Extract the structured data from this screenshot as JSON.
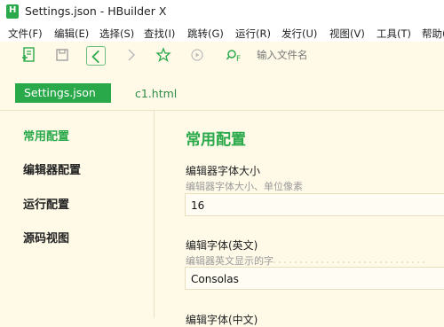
{
  "window": {
    "title": "Settings.json - HBuilder X"
  },
  "menu": [
    "文件(F)",
    "编辑(E)",
    "选择(S)",
    "查找(I)",
    "跳转(G)",
    "运行(R)",
    "发行(U)",
    "视图(V)",
    "工具(T)",
    "帮助(Y)"
  ],
  "toolbar": {
    "search_placeholder": "输入文件名",
    "search_icon_label": "F"
  },
  "tabs": {
    "active": "Settings.json",
    "other": "c1.html"
  },
  "sidebar": {
    "items": [
      "常用配置",
      "编辑器配置",
      "运行配置",
      "源码视图"
    ]
  },
  "main": {
    "title": "常用配置",
    "fields": [
      {
        "label": "编辑器字体大小",
        "hint": "编辑器字体大小、单位像素",
        "value": "16"
      },
      {
        "label": "编辑字体(英文)",
        "hint": "编辑器英文显示的字",
        "value": "Consolas"
      },
      {
        "label": "编辑字体(中文)"
      }
    ]
  },
  "colors": {
    "accent": "#2aa94b",
    "background": "#fffae8"
  }
}
